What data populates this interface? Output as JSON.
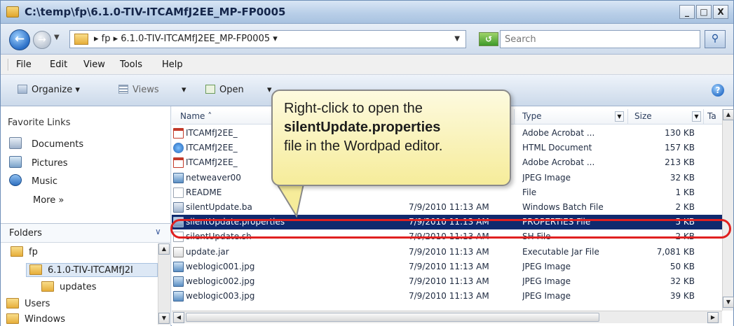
{
  "window": {
    "title": "C:\\temp\\fp\\6.1.0-TIV-ITCAMfJ2EE_MP-FP0005",
    "controls": {
      "minimize": "_",
      "maximize": "□",
      "close": "X"
    }
  },
  "address_bar": {
    "path": "▸ fp ▸ 6.1.0-TIV-ITCAMfJ2EE_MP-FP0005 ▾",
    "search_placeholder": "Search"
  },
  "menu": [
    "File",
    "Edit",
    "View",
    "Tools",
    "Help"
  ],
  "toolbar": {
    "organize": "Organize",
    "views": "Views",
    "open": "Open"
  },
  "favorites": {
    "heading": "Favorite Links",
    "items": [
      "Documents",
      "Pictures",
      "Music"
    ],
    "more": "More"
  },
  "folders": {
    "heading": "Folders",
    "tree": [
      "fp",
      "6.1.0-TIV-ITCAMfJ2I",
      "updates",
      "Users",
      "Windows"
    ]
  },
  "columns": {
    "name": "Name",
    "type": "Type",
    "size": "Size",
    "tags": "Ta"
  },
  "files": [
    {
      "name": "ITCAMfJ2EE_",
      "date": "",
      "type": "Adobe Acrobat ...",
      "size": "130 KB",
      "icon": "pdf-icon"
    },
    {
      "name": "ITCAMfJ2EE_",
      "date": "",
      "type": "HTML Document",
      "size": "157 KB",
      "icon": "html-icon"
    },
    {
      "name": "ITCAMfJ2EE_",
      "date": "",
      "type": "Adobe Acrobat ...",
      "size": "213 KB",
      "icon": "pdf-icon"
    },
    {
      "name": "netweaver00",
      "date": "",
      "type": "JPEG Image",
      "size": "32 KB",
      "icon": "image-icon"
    },
    {
      "name": "README",
      "date": "",
      "type": "File",
      "size": "1 KB",
      "icon": "file-icon"
    },
    {
      "name": "silentUpdate.ba",
      "date": "7/9/2010 11:13 AM",
      "type": "Windows Batch File",
      "size": "2 KB",
      "icon": "batch-icon"
    },
    {
      "name": "silentUpdate.properties",
      "date": "7/9/2010 11:13 AM",
      "type": "PROPERTIES File",
      "size": "5 KB",
      "icon": "properties-icon"
    },
    {
      "name": "silentUpdate.sh",
      "date": "7/9/2010 11:13 AM",
      "type": "SH File",
      "size": "2 KB",
      "icon": "file-icon"
    },
    {
      "name": "update.jar",
      "date": "7/9/2010 11:13 AM",
      "type": "Executable Jar File",
      "size": "7,081 KB",
      "icon": "jar-icon"
    },
    {
      "name": "weblogic001.jpg",
      "date": "7/9/2010 11:13 AM",
      "type": "JPEG Image",
      "size": "50 KB",
      "icon": "image-icon"
    },
    {
      "name": "weblogic002.jpg",
      "date": "7/9/2010 11:13 AM",
      "type": "JPEG Image",
      "size": "32 KB",
      "icon": "image-icon"
    },
    {
      "name": "weblogic003.jpg",
      "date": "7/9/2010 11:13 AM",
      "type": "JPEG Image",
      "size": "39 KB",
      "icon": "image-icon"
    }
  ],
  "callout": {
    "line1": "Right-click to open the",
    "line2": "silentUpdate.properties",
    "line3": "file in the Wordpad editor."
  },
  "colors": {
    "selection": "#0f2a6e",
    "highlight_ring": "#e02020",
    "callout_fill": "#f6ec9a"
  }
}
